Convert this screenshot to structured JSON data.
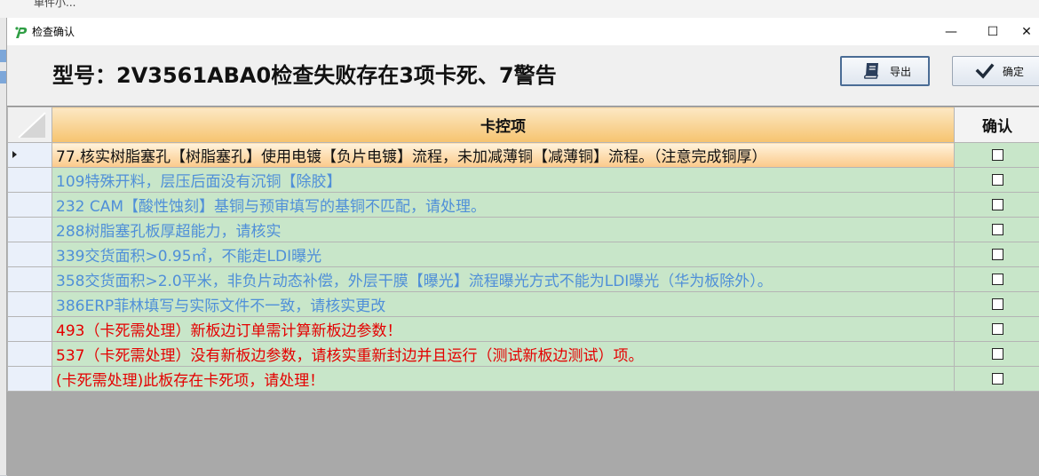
{
  "background": {
    "top_text": "单件小..."
  },
  "window": {
    "title": "检查确认",
    "minimize_glyph": "—",
    "maximize_glyph": "☐",
    "close_glyph": "✕"
  },
  "header": {
    "heading": "型号：2V3561ABA0检查失败存在3项卡死、7警告"
  },
  "toolbar": {
    "export_label": "导出",
    "confirm_label": "确定"
  },
  "table": {
    "columns": {
      "item": "卡控项",
      "confirm": "确认"
    },
    "rows": [
      {
        "text": "77.核实树脂塞孔【树脂塞孔】使用电镀【负片电镀】流程，未加减薄铜【减薄铜】流程。（注意完成铜厚）",
        "color": "#111111",
        "selected": true,
        "checked": false
      },
      {
        "text": "109特殊开料，层压后面没有沉铜【除胶】",
        "color": "#4f8fd8",
        "selected": false,
        "checked": false
      },
      {
        "text": "232 CAM【酸性蚀刻】基铜与预审填写的基铜不匹配，请处理。",
        "color": "#4f8fd8",
        "selected": false,
        "checked": false
      },
      {
        "text": "288树脂塞孔板厚超能力，请核实",
        "color": "#4f8fd8",
        "selected": false,
        "checked": false
      },
      {
        "text": "339交货面积>0.95㎡，不能走LDI曝光",
        "color": "#4f8fd8",
        "selected": false,
        "checked": false
      },
      {
        "text": "358交货面积>2.0平米，非负片动态补偿，外层干膜【曝光】流程曝光方式不能为LDI曝光（华为板除外）。",
        "color": "#4f8fd8",
        "selected": false,
        "checked": false
      },
      {
        "text": "386ERP菲林填写与实际文件不一致，请核实更改",
        "color": "#4f8fd8",
        "selected": false,
        "checked": false
      },
      {
        "text": "493（卡死需处理）新板边订单需计算新板边参数！",
        "color": "#e40000",
        "selected": false,
        "checked": false
      },
      {
        "text": "537（卡死需处理）没有新板边参数，请核实重新封边并且运行（测试新板边测试）项。",
        "color": "#e40000",
        "selected": false,
        "checked": false
      },
      {
        "text": "(卡死需处理)此板存在卡死项，请处理！",
        "color": "#e40000",
        "selected": false,
        "checked": false
      }
    ]
  },
  "colors": {
    "row_bg": "#c8e6c9",
    "selected_row_bg": "#fbc98a",
    "header_bg": "#f6c36f",
    "warning_text": "#4f8fd8",
    "fatal_text": "#e40000"
  },
  "icons": {
    "app": "app-logo-icon",
    "export": "book-icon",
    "confirm": "checkmark-icon"
  }
}
